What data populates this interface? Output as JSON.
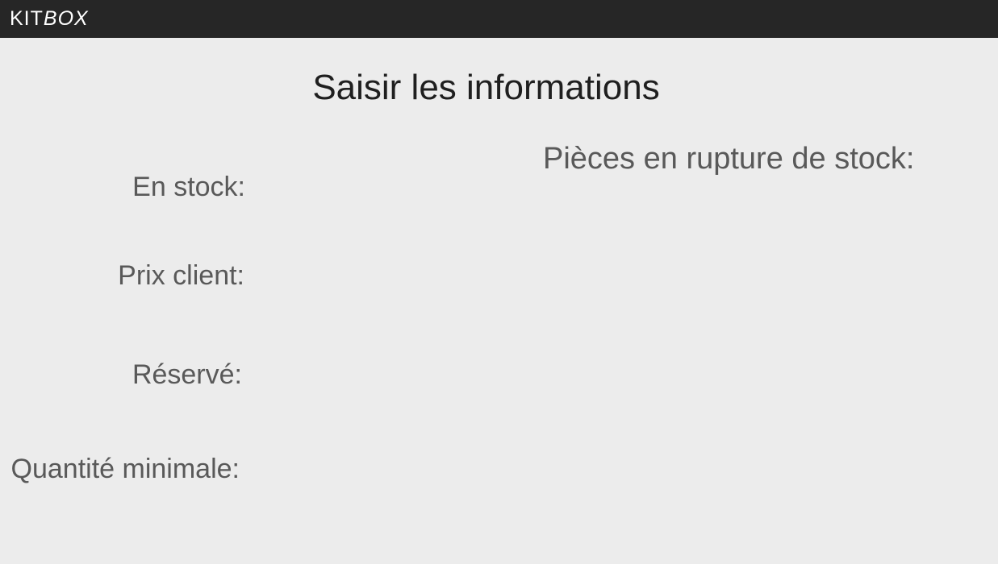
{
  "header": {
    "logo_kit": "KIT",
    "logo_box": "BOX"
  },
  "page": {
    "title": "Saisir les informations"
  },
  "form": {
    "labels": {
      "en_stock": "En stock:",
      "prix_client": "Prix client:",
      "reserve": "Réservé:",
      "quantite_minimale": "Quantité minimale:"
    }
  },
  "out_of_stock": {
    "title": "Pièces en rupture de stock:"
  },
  "colors": {
    "topbar": "#262626",
    "background": "#ececec",
    "title_text": "#1f1f1f",
    "label_text": "#595959"
  }
}
